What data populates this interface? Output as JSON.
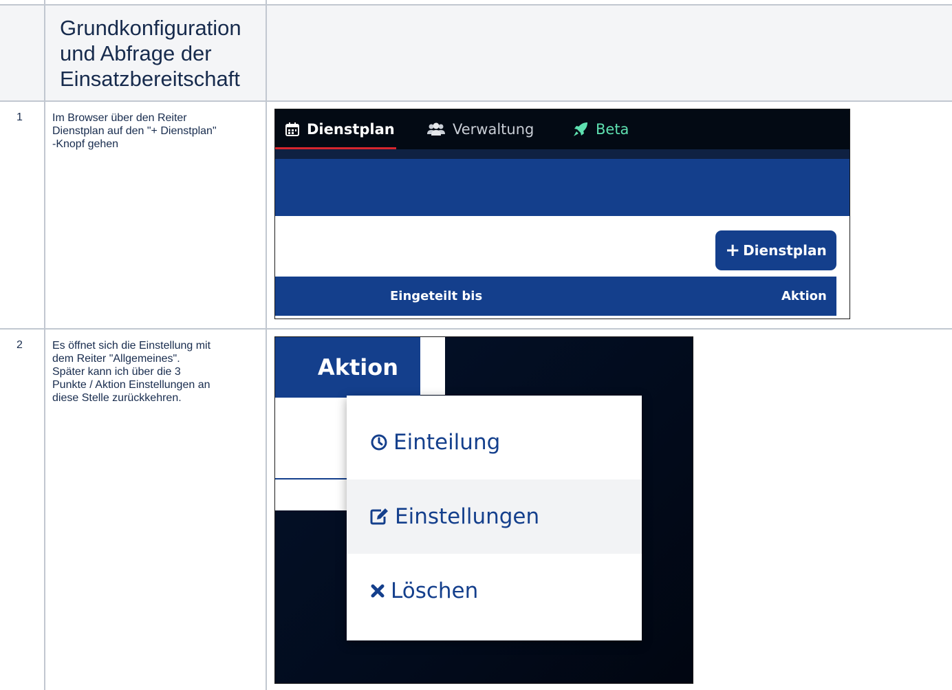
{
  "table": {
    "header": {
      "title": "Grundkonfiguration und Abfrage der Einsatzbereitschaft",
      "title_lines": [
        "Grundkonfiguration",
        "und Abfrage der",
        "Einsatzbereitschaft"
      ]
    },
    "rows": [
      {
        "number": "1",
        "description_lines": [
          "Im Browser über den Reiter",
          "Dienstplan auf den \"+ Dienstplan\"",
          "-Knopf gehen"
        ]
      },
      {
        "number": "2",
        "description_lines": [
          "Es öffnet sich die Einstellung mit",
          "dem Reiter \"Allgemeines\".",
          "Später kann ich über die 3",
          "Punkte / Aktion Einstellungen an",
          "diese Stelle zurückkehren."
        ]
      }
    ]
  },
  "screenshot1": {
    "tabs": [
      {
        "label": "Dienstplan",
        "icon": "calendar-icon",
        "active": true
      },
      {
        "label": "Verwaltung",
        "icon": "users-icon",
        "active": false
      },
      {
        "label": "Beta",
        "icon": "rocket-icon",
        "active": false
      }
    ],
    "add_button": {
      "plus": "+",
      "label": "Dienstplan"
    },
    "table_headers": [
      "Eingeteilt bis",
      "Aktion"
    ],
    "colors": {
      "nav": "#030a14",
      "primary": "#143f8c",
      "active_underline": "#d7262e",
      "beta": "#5ee0b0"
    }
  },
  "screenshot2": {
    "column_header": "Aktion",
    "menu_items": [
      {
        "label": "Einteilung",
        "icon": "clock-icon"
      },
      {
        "label": "Einstellungen",
        "icon": "edit-icon"
      },
      {
        "label": "Löschen",
        "icon": "times-icon"
      }
    ],
    "colors": {
      "primary": "#143f8c",
      "background": "#031028"
    }
  }
}
